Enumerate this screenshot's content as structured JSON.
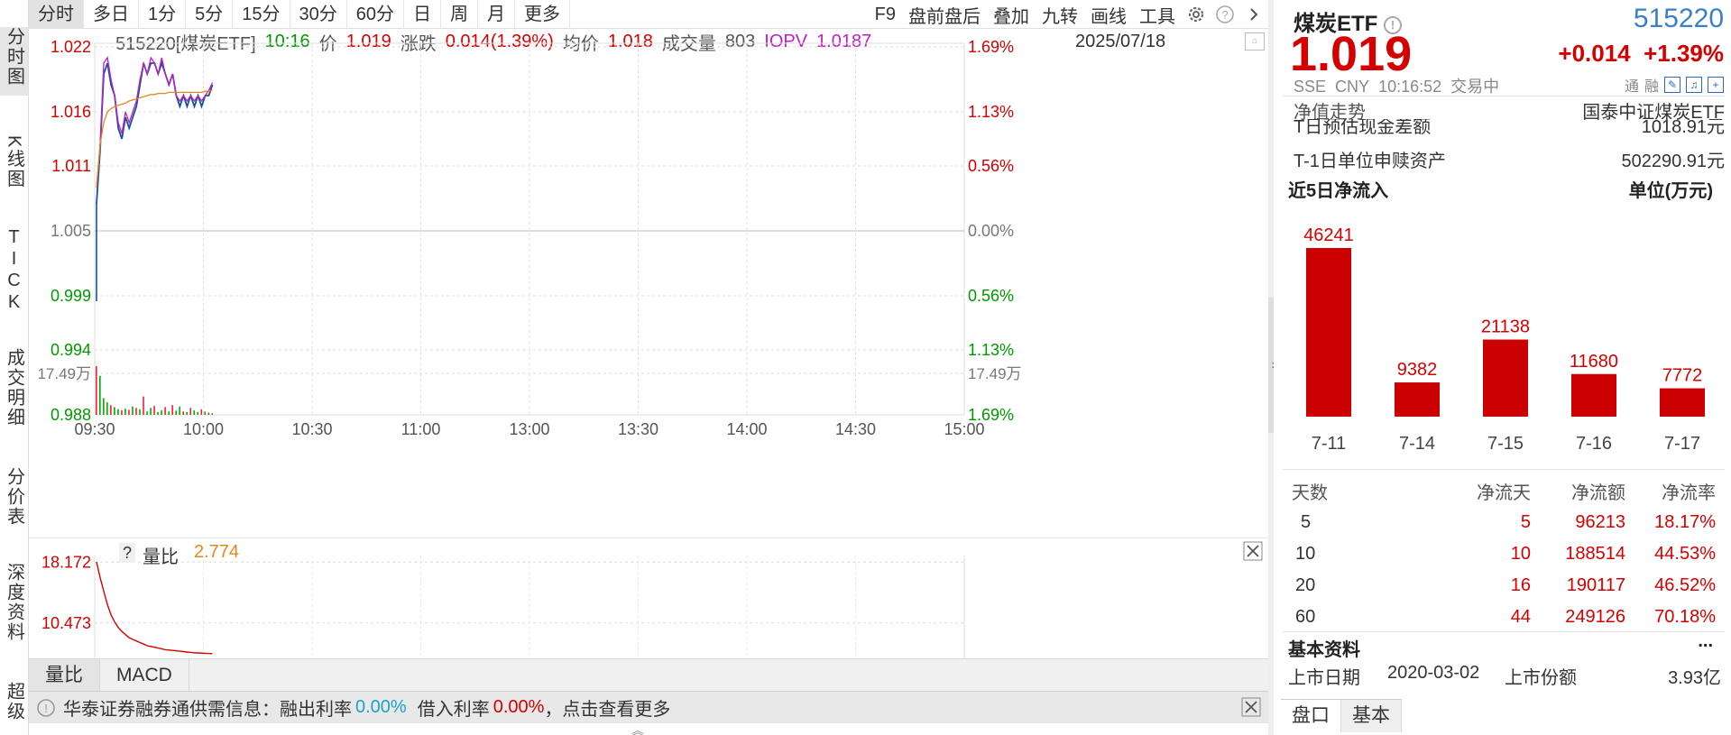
{
  "left_nav": {
    "tabs": [
      "分时图",
      "K线图",
      "TICK",
      "成交明细",
      "分价表",
      "深度资料",
      "超级"
    ]
  },
  "toolbar": {
    "period_tabs": [
      "分时",
      "多日",
      "1分",
      "5分",
      "15分",
      "30分",
      "60分",
      "日",
      "周",
      "月",
      "更多"
    ],
    "right_buttons": [
      "F9",
      "盘前盘后",
      "叠加",
      "九转",
      "画线",
      "工具"
    ],
    "icons": [
      "gear-icon",
      "help-icon",
      "chevron-right-icon"
    ]
  },
  "info": {
    "code_name": "515220[煤炭ETF]",
    "time": "10:16",
    "price_label": "价",
    "price": "1.019",
    "change_label": "涨跌",
    "change": "0.014(1.39%)",
    "avg_label": "均价",
    "avg": "1.018",
    "volume_label": "成交量",
    "volume": "803",
    "iopv_label": "IOPV",
    "iopv": "1.0187",
    "date": "2025/07/18"
  },
  "chart_data": {
    "type": "line",
    "y_left_ticks": [
      "1.022",
      "1.016",
      "1.011",
      "1.005",
      "0.999",
      "0.994",
      "0.988"
    ],
    "y_right_ticks": [
      "1.69%",
      "1.13%",
      "0.56%",
      "0.00%",
      "0.56%",
      "1.13%",
      "1.69%"
    ],
    "ylim": [
      0.988,
      1.022
    ],
    "prev_close": 1.005,
    "x_ticks": [
      "09:30",
      "10:00",
      "10:30",
      "11:00",
      "13:00",
      "13:30",
      "14:00",
      "14:30",
      "15:00"
    ],
    "volume_label_left": "17.49万",
    "volume_label_right": "17.49万",
    "series": [
      {
        "name": "价",
        "color": "#1a4fa0",
        "values": [
          1.0075,
          1.0125,
          1.0195,
          1.0205,
          1.0185,
          1.0175,
          1.0145,
          1.0135,
          1.0155,
          1.0145,
          1.0155,
          1.0165,
          1.0185,
          1.0205,
          1.0195,
          1.0205,
          1.0205,
          1.0195,
          1.0205,
          1.0195,
          1.0185,
          1.0195,
          1.0175,
          1.0165,
          1.0175,
          1.0165,
          1.0175,
          1.0165,
          1.0175,
          1.0165,
          1.0175,
          1.0175,
          1.0185
        ]
      },
      {
        "name": "IOPV",
        "color": "#c020c0",
        "values": [
          1.009,
          1.013,
          1.0205,
          1.021,
          1.019,
          1.0175,
          1.015,
          1.014,
          1.016,
          1.015,
          1.016,
          1.017,
          1.019,
          1.0205,
          1.0195,
          1.021,
          1.0205,
          1.0195,
          1.021,
          1.0195,
          1.0185,
          1.0195,
          1.0175,
          1.017,
          1.0175,
          1.017,
          1.0175,
          1.017,
          1.0175,
          1.017,
          1.0175,
          1.018,
          1.0187
        ]
      },
      {
        "name": "均价",
        "color": "#e08a1e",
        "values": [
          1.009,
          1.013,
          1.015,
          1.016,
          1.0163,
          1.0165,
          1.0166,
          1.0167,
          1.0168,
          1.017,
          1.0171,
          1.0172,
          1.0173,
          1.0174,
          1.0175,
          1.0176,
          1.0176,
          1.0177,
          1.0177,
          1.0177,
          1.0178,
          1.0178,
          1.0178,
          1.0178,
          1.0178,
          1.0178,
          1.0178,
          1.0178,
          1.0178,
          1.0178,
          1.0179,
          1.0179,
          1.018
        ]
      }
    ],
    "volume_bars": [
      {
        "v": 17.49,
        "c": "r"
      },
      {
        "v": 14.0,
        "c": "g"
      },
      {
        "v": 6.0,
        "c": "g"
      },
      {
        "v": 4.5,
        "c": "g"
      },
      {
        "v": 3.5,
        "c": "r"
      },
      {
        "v": 2.8,
        "c": "g"
      },
      {
        "v": 2.0,
        "c": "g"
      },
      {
        "v": 1.6,
        "c": "r"
      },
      {
        "v": 2.2,
        "c": "g"
      },
      {
        "v": 1.8,
        "c": "r"
      },
      {
        "v": 3.0,
        "c": "g"
      },
      {
        "v": 2.5,
        "c": "r"
      },
      {
        "v": 2.0,
        "c": "g"
      },
      {
        "v": 6.6,
        "c": "r"
      },
      {
        "v": 1.2,
        "c": "g"
      },
      {
        "v": 2.5,
        "c": "g"
      },
      {
        "v": 3.2,
        "c": "r"
      },
      {
        "v": 1.0,
        "c": "g"
      },
      {
        "v": 1.6,
        "c": "g"
      },
      {
        "v": 2.8,
        "c": "r"
      },
      {
        "v": 1.2,
        "c": "g"
      },
      {
        "v": 3.5,
        "c": "r"
      },
      {
        "v": 1.5,
        "c": "g"
      },
      {
        "v": 3.0,
        "c": "g"
      },
      {
        "v": 1.2,
        "c": "r"
      },
      {
        "v": 1.0,
        "c": "g"
      },
      {
        "v": 2.5,
        "c": "r"
      },
      {
        "v": 1.6,
        "c": "g"
      },
      {
        "v": 1.0,
        "c": "g"
      },
      {
        "v": 2.0,
        "c": "r"
      },
      {
        "v": 1.2,
        "c": "g"
      },
      {
        "v": 0.8,
        "c": "r"
      },
      {
        "v": 0.6,
        "c": "g"
      }
    ]
  },
  "sub_chart": {
    "help": "?",
    "label": "量比",
    "value": "2.774",
    "y_ticks": [
      "18.172",
      "10.473"
    ],
    "ylim": [
      6.0,
      19.0
    ],
    "values": [
      18.2,
      16.2,
      14.5,
      12.8,
      11.5,
      10.6,
      9.9,
      9.4,
      9.0,
      8.6,
      8.4,
      8.2,
      8.0,
      7.8,
      7.6,
      7.5,
      7.4,
      7.3,
      7.2,
      7.1,
      7.05,
      7.0,
      6.95,
      6.9,
      6.85,
      6.8,
      6.75,
      6.7,
      6.68,
      6.66,
      6.64,
      6.62,
      6.6
    ]
  },
  "bottom_tabs": [
    "量比",
    "MACD"
  ],
  "notice": {
    "prefix": "华泰证券融券通供需信息：融出利率",
    "rate1": "0.00%",
    "mid": "借入利率",
    "rate2": "0.00%",
    "suffix": "，点击查看更多"
  },
  "quote": {
    "name": "煤炭ETF",
    "code": "515220",
    "price": "1.019",
    "change": "+0.014",
    "change_pct": "+1.39%",
    "market": "SSE",
    "currency": "CNY",
    "time": "10:16:52",
    "status": "交易中",
    "badges": [
      "通",
      "融"
    ],
    "nav_label": "净值走势",
    "nav_index": "国泰中证煤炭ETF",
    "rows": [
      {
        "label": "T日预估现金差额",
        "value": "1018.91元"
      },
      {
        "label": "T-1日单位申赎资产",
        "value": "502290.91元"
      }
    ]
  },
  "netflow": {
    "title": "近5日净流入",
    "unit": "单位(万元)",
    "chart_data": {
      "type": "bar",
      "categories": [
        "7-11",
        "7-14",
        "7-15",
        "7-16",
        "7-17"
      ],
      "values": [
        46241,
        9382,
        21138,
        11680,
        7772
      ],
      "color": "#cc0000"
    },
    "table_headers": [
      "天数",
      "净流天",
      "净流额",
      "净流率"
    ],
    "table_rows": [
      [
        "5",
        "5",
        "96213",
        "18.17%"
      ],
      [
        "10",
        "10",
        "188514",
        "44.53%"
      ],
      [
        "20",
        "16",
        "190117",
        "46.52%"
      ],
      [
        "60",
        "44",
        "249126",
        "70.18%"
      ]
    ]
  },
  "basic_info": {
    "title": "基本资料",
    "more": "...",
    "listing_date_label": "上市日期",
    "listing_date": "2020-03-02",
    "shares_label": "上市份额",
    "shares": "3.93亿"
  },
  "right_tabs": [
    "盘口",
    "基本"
  ],
  "colors": {
    "up": "#d40000",
    "down": "#009900",
    "price_line": "#1a4fa0",
    "iopv_line": "#c020c0",
    "avg_line": "#e08a1e",
    "code_blue": "#3b7fc4",
    "cyan": "#1aa3c8"
  }
}
